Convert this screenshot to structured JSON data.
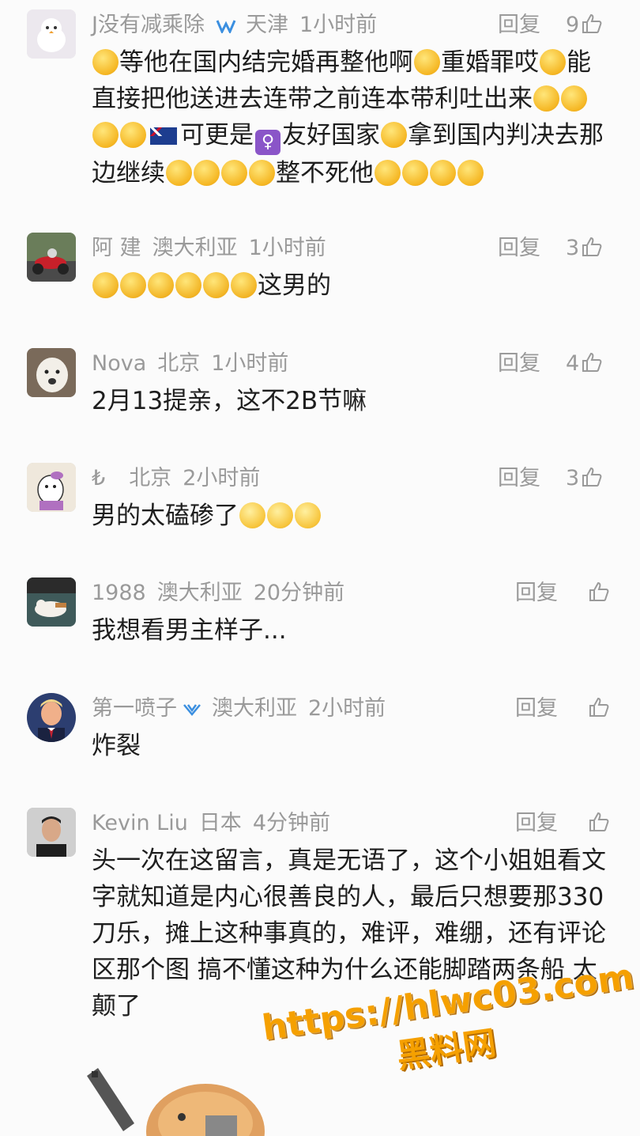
{
  "comments": [
    {
      "username": "J没有减乘除",
      "badge": "vip-badge",
      "location": "天津",
      "time": "1小时前",
      "reply_label": "回复",
      "likes": "9",
      "body_html_parts": [
        "等他在国内结完婚再整他啊",
        "重婚罪哎",
        "能直接把他送进去连带之前连本带利吐出来",
        "可更是",
        "友好国家",
        "拿到国内判决去那边继续",
        "整不死他"
      ]
    },
    {
      "username": "阿 建",
      "location": "澳大利亚",
      "time": "1小时前",
      "reply_label": "回复",
      "likes": "3",
      "body_text": "这男的"
    },
    {
      "username": "Nova",
      "location": "北京",
      "time": "1小时前",
      "reply_label": "回复",
      "likes": "4",
      "body_text": "2月13提亲，这不2B节嘛"
    },
    {
      "username": "₺",
      "location": "北京",
      "time": "2小时前",
      "reply_label": "回复",
      "likes": "3",
      "body_text": "男的太磕碜了"
    },
    {
      "username": "1988",
      "location": "澳大利亚",
      "time": "20分钟前",
      "reply_label": "回复",
      "likes": "",
      "body_text": "我想看男主样子..."
    },
    {
      "username": "第一喷子",
      "badge": "vip-badge",
      "location": "澳大利亚",
      "time": "2小时前",
      "reply_label": "回复",
      "likes": "",
      "body_text": "炸裂"
    },
    {
      "username": "Kevin Liu",
      "location": "日本",
      "time": "4分钟前",
      "reply_label": "回复",
      "likes": "",
      "body_text": "头一次在这留言，真是无语了，这个小姐姐看文字就知道是内心很善良的人，最后只想要那330刀乐，摊上这种事真的，难评，难绷，还有评论区那个图 搞不懂这种为什么还能脚踏两条船 太颠了"
    }
  ],
  "watermark": {
    "url": "https://hlwc03.com",
    "name": "黑料网"
  },
  "icons": {
    "like": "thumbs-up-icon",
    "badge": "vip-badge-icon",
    "emoji": "emoji-icon"
  },
  "colors": {
    "meta": "#9a9a9a",
    "text": "#1e1e1e",
    "watermark": "#f5a000",
    "badge": "#3b8fe0"
  }
}
